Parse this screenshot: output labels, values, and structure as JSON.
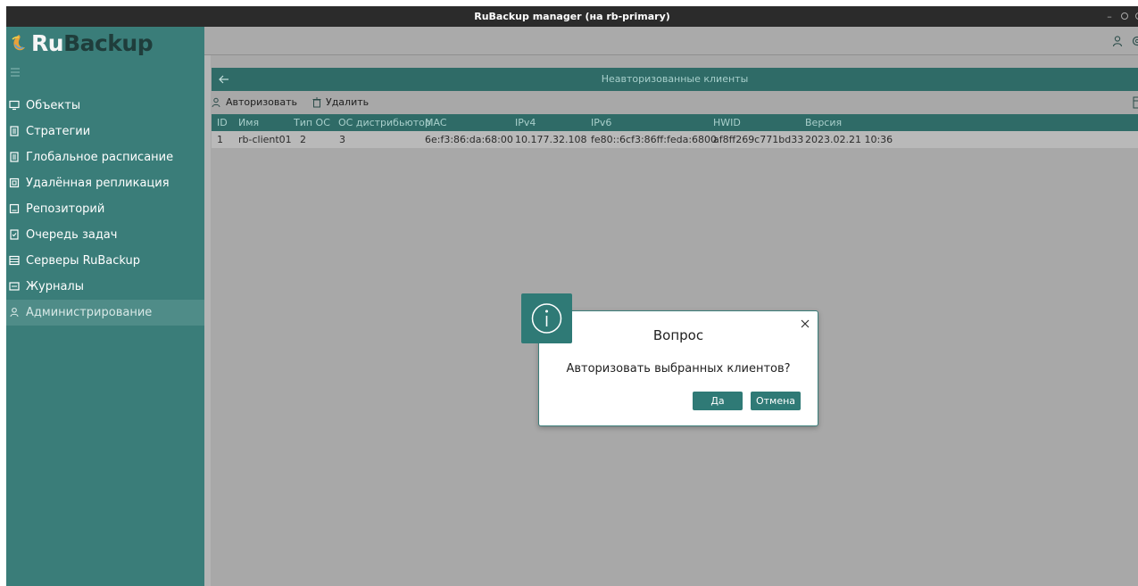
{
  "window": {
    "title": "RuBackup manager (на rb-primary)"
  },
  "logo": {
    "ru": "Ru",
    "backup": "Backup"
  },
  "sidebar": {
    "items": [
      {
        "label": "Объекты",
        "icon": "monitor-icon"
      },
      {
        "label": "Стратегии",
        "icon": "document-icon"
      },
      {
        "label": "Глобальное расписание",
        "icon": "calendar-icon"
      },
      {
        "label": "Удалённая репликация",
        "icon": "replication-icon"
      },
      {
        "label": "Репозиторий",
        "icon": "repository-icon"
      },
      {
        "label": "Очередь задач",
        "icon": "task-queue-icon"
      },
      {
        "label": "Серверы RuBackup",
        "icon": "server-icon"
      },
      {
        "label": "Журналы",
        "icon": "log-icon"
      },
      {
        "label": "Администрирование",
        "icon": "user-icon",
        "active": true
      }
    ]
  },
  "panel": {
    "title": "Неавторизованные клиенты"
  },
  "toolbar": {
    "authorize_label": "Авторизовать",
    "delete_label": "Удалить"
  },
  "table": {
    "columns": [
      "ID",
      "Имя",
      "Тип ОС",
      "ОС дистрибьютор",
      "MAC",
      "IPv4",
      "IPv6",
      "HWID",
      "Версия"
    ],
    "rows": [
      [
        "1",
        "rb-client01",
        "2",
        "3",
        "6e:f3:86:da:68:00",
        "10.177.32.108",
        "fe80::6cf3:86ff:feda:6800",
        "af8ff269c771bd33",
        "2023.02.21 10:36"
      ]
    ]
  },
  "dialog": {
    "title": "Вопрос",
    "message": "Авторизовать выбранных клиентов?",
    "yes_label": "Да",
    "cancel_label": "Отмена"
  },
  "colors": {
    "accent": "#2f7a76",
    "sidebar": "#3a7d79",
    "header": "#2f6b67"
  }
}
